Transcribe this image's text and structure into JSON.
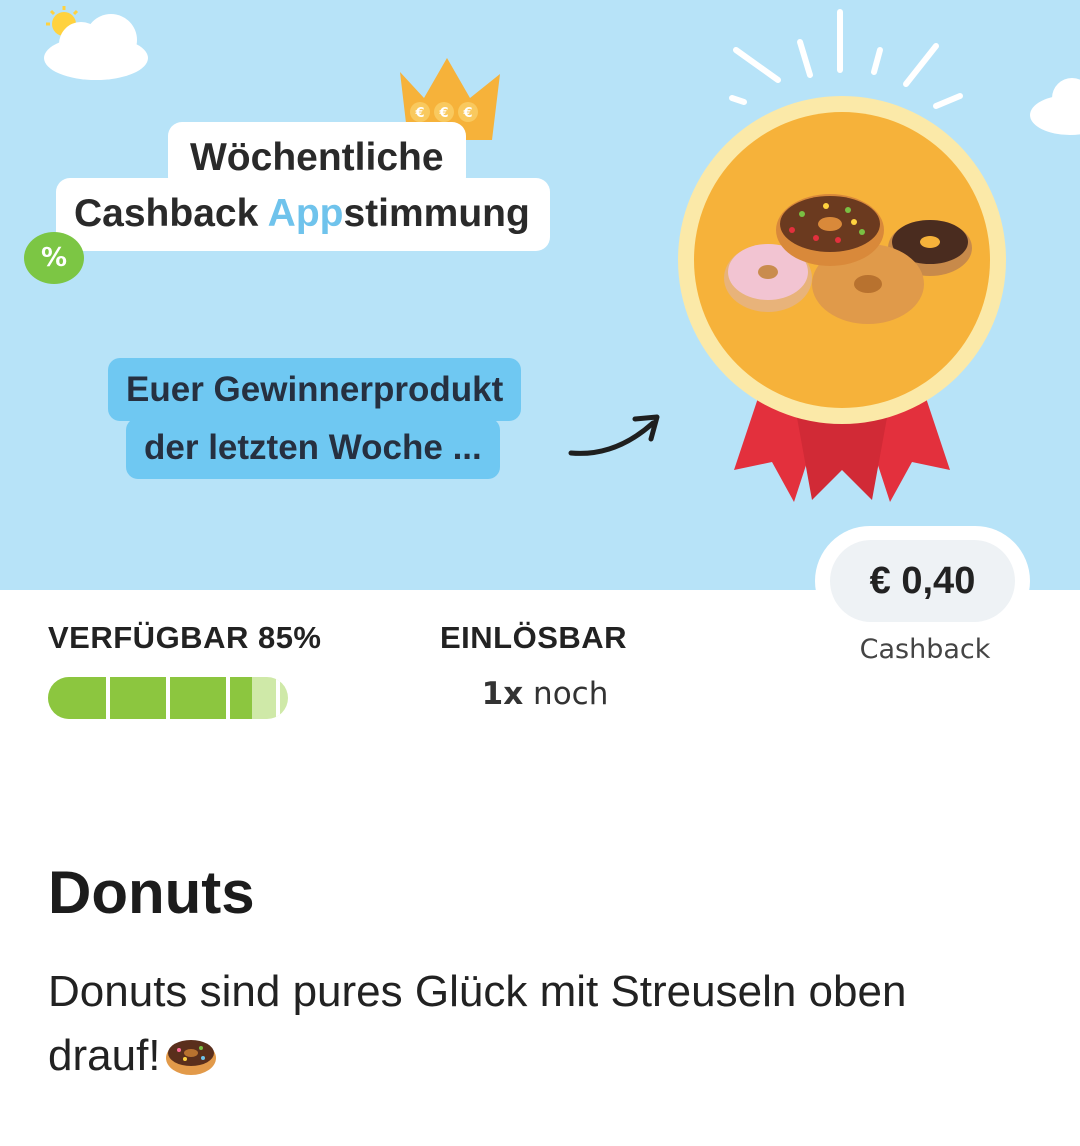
{
  "banner": {
    "title_line1": "Wöchentliche",
    "title_line2_part1": "Cashback ",
    "title_line2_accent": "App",
    "title_line2_part2": "stimmung",
    "percent_badge": "%",
    "winner_line1": "Euer Gewinnerprodukt",
    "winner_line2": "der letzten Woche ...",
    "colors": {
      "sky": "#b7e3f8",
      "accent": "#6fc3ec",
      "green": "#7cc644",
      "medal": "#f6b23a",
      "ribbon": "#e3303d"
    }
  },
  "price": {
    "amount": "€ 0,40",
    "label": "Cashback"
  },
  "stats": {
    "available_label": "VERFÜGBAR 85%",
    "available_percent": 85,
    "redeemable_label": "EINLÖSBAR",
    "redeemable_count": "1x",
    "redeemable_suffix": " noch"
  },
  "product": {
    "title": "Donuts",
    "description": "Donuts sind pures Glück mit Streuseln oben drauf!",
    "description_icon": "donut-emoji-icon"
  }
}
